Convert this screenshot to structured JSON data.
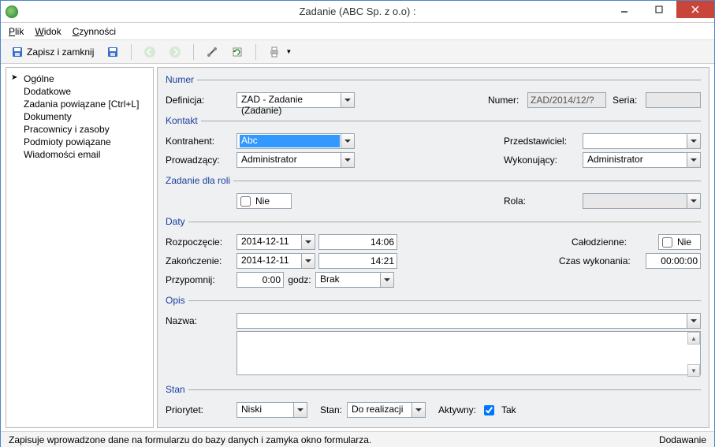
{
  "window": {
    "title": "Zadanie (ABC Sp. z o.o) :"
  },
  "menu": {
    "plik": "Plik",
    "widok": "Widok",
    "czynnosci": "Czynności"
  },
  "toolbar": {
    "save_close": "Zapisz i zamknij"
  },
  "nav": {
    "items": [
      "Ogólne",
      "Dodatkowe",
      "Zadania powiązane [Ctrl+L]",
      "Dokumenty",
      "Pracownicy i zasoby",
      "Podmioty powiązane",
      "Wiadomości email"
    ]
  },
  "groups": {
    "numer": "Numer",
    "kontakt": "Kontakt",
    "zadanie_roli": "Zadanie dla roli",
    "daty": "Daty",
    "opis": "Opis",
    "stan": "Stan"
  },
  "labels": {
    "definicja": "Definicja:",
    "numer": "Numer:",
    "seria": "Seria:",
    "kontrahent": "Kontrahent:",
    "przedstawiciel": "Przedstawiciel:",
    "prowadzacy": "Prowadzący:",
    "wykonujacy": "Wykonujący:",
    "rola": "Rola:",
    "rozpoczecie": "Rozpoczęcie:",
    "zakonczenie": "Zakończenie:",
    "przypomnij": "Przypomnij:",
    "godz": "godz:",
    "calodzienne": "Całodzienne:",
    "czas_wykonania": "Czas wykonania:",
    "nazwa": "Nazwa:",
    "priorytet": "Priorytet:",
    "stan": "Stan:",
    "aktywny": "Aktywny:"
  },
  "values": {
    "definicja": "ZAD - Zadanie (Zadanie)",
    "numer": "ZAD/2014/12/?",
    "seria": "",
    "kontrahent": "Abc",
    "przedstawiciel": "",
    "prowadzacy": "Administrator",
    "wykonujacy": "Administrator",
    "zadanie_roli_check": "Nie",
    "rola": "",
    "rozp_date": "2014-12-11",
    "rozp_time": "14:06",
    "zak_date": "2014-12-11",
    "zak_time": "14:21",
    "przypomnij_val": "0:00",
    "przypomnij_brak": "Brak",
    "calodzienne_check": "Nie",
    "czas_wykonania": "00:00:00",
    "nazwa": "",
    "opis_text": "",
    "priorytet": "Niski",
    "stan": "Do realizacji",
    "aktywny_check": "Tak"
  },
  "status": {
    "left": "Zapisuje wprowadzone dane na formularzu do bazy danych i zamyka okno formularza.",
    "right": "Dodawanie"
  }
}
